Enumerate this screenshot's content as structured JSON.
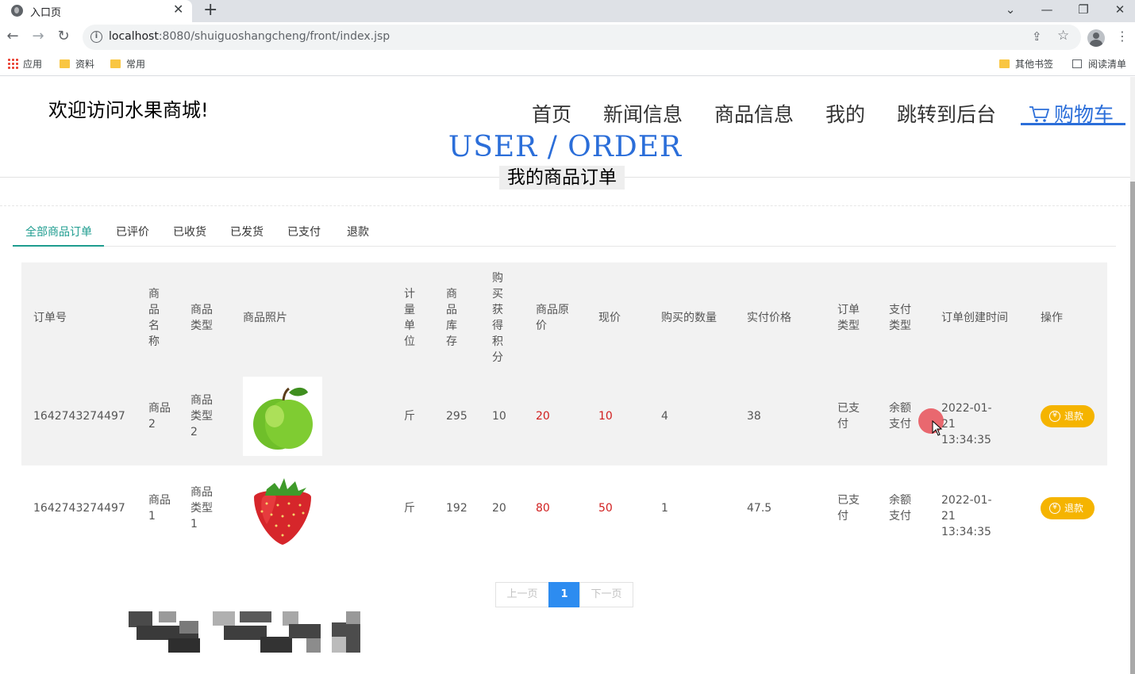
{
  "browser": {
    "tab_title": "入口页",
    "url_host": "localhost",
    "url_rest": ":8080/shuiguoshangcheng/front/index.jsp",
    "bookmarks": [
      {
        "label": "应用",
        "icon": "apps-grid-icon"
      },
      {
        "label": "资料",
        "icon": "folder-icon"
      },
      {
        "label": "常用",
        "icon": "folder-icon"
      }
    ],
    "bookmarks_right": [
      {
        "label": "其他书签",
        "icon": "folder-icon"
      },
      {
        "label": "阅读清单",
        "icon": "reading-list-icon"
      }
    ]
  },
  "site": {
    "welcome": "欢迎访问水果商城!",
    "nav": [
      "首页",
      "新闻信息",
      "商品信息",
      "我的",
      "跳转到后台"
    ],
    "cart_label": "购物车",
    "accent": "#2b6ed9"
  },
  "section": {
    "english_title": "USER / ORDER",
    "chinese_title": "我的商品订单"
  },
  "order_tabs": [
    "全部商品订单",
    "已评价",
    "已收货",
    "已发货",
    "已支付",
    "退款"
  ],
  "table": {
    "headers": [
      "订单号",
      "商品名称",
      "商品类型",
      "商品照片",
      "计量单位",
      "商品库存",
      "购买获得积分",
      "商品原价",
      "现价",
      "购买的数量",
      "实付价格",
      "订单类型",
      "支付类型",
      "订单创建时间",
      "操作"
    ],
    "rows": [
      {
        "order_no": "1642743274497",
        "name": "商品2",
        "type": "商品类型2",
        "photo": "green-apple",
        "unit": "斤",
        "stock": "295",
        "points": "10",
        "orig_price": "20",
        "price": "10",
        "qty": "4",
        "paid": "38",
        "order_type": "已支付",
        "pay_type": "余额支付",
        "created": "2022-01-21 13:34:35",
        "action": "退款"
      },
      {
        "order_no": "1642743274497",
        "name": "商品1",
        "type": "商品类型1",
        "photo": "strawberry",
        "unit": "斤",
        "stock": "192",
        "points": "20",
        "orig_price": "80",
        "price": "50",
        "qty": "1",
        "paid": "47.5",
        "order_type": "已支付",
        "pay_type": "余额支付",
        "created": "2022-01-21 13:34:35",
        "action": "退款"
      }
    ]
  },
  "pagination": {
    "prev": "上一页",
    "current": "1",
    "next": "下一页"
  },
  "colors": {
    "active_tab": "#1e9c8f",
    "price_red": "#d11f1f",
    "refund_button": "#f5b400",
    "page_current": "#2d8cf0"
  }
}
